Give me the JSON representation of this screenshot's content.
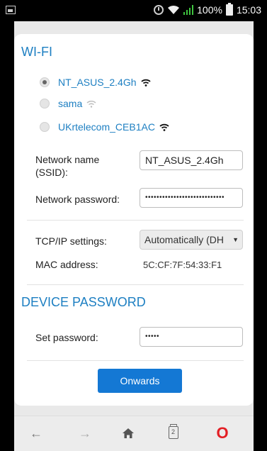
{
  "status_bar": {
    "battery": "100%",
    "time": "15:03"
  },
  "wifi": {
    "title": "WI-FI",
    "networks": [
      {
        "ssid": "NT_ASUS_2.4Gh",
        "selected": true,
        "signal": "strong"
      },
      {
        "ssid": "sama",
        "selected": false,
        "signal": "weak"
      },
      {
        "ssid": "UKrtelecom_CEB1AC",
        "selected": false,
        "signal": "strong"
      }
    ],
    "ssid_label": "Network name (SSID):",
    "ssid_value": "NT_ASUS_2.4Gh",
    "password_label": "Network password:",
    "password_value": "••••••••••••••••••••••••••••"
  },
  "network": {
    "tcpip_label": "TCP/IP settings:",
    "tcpip_value": "Automatically (DH",
    "mac_label": "MAC address:",
    "mac_value": "5C:CF:7F:54:33:F1"
  },
  "device_password": {
    "title": "DEVICE PASSWORD",
    "set_label": "Set password:",
    "set_value": "•••••"
  },
  "actions": {
    "onwards_label": "Onwards"
  },
  "nav": {
    "back": "←",
    "forward": "→",
    "home": "⌂",
    "tabs_count": "2",
    "opera": "O"
  },
  "colors": {
    "accent": "#1d7fc2",
    "button": "#1478d4",
    "opera_red": "#e31e24"
  }
}
